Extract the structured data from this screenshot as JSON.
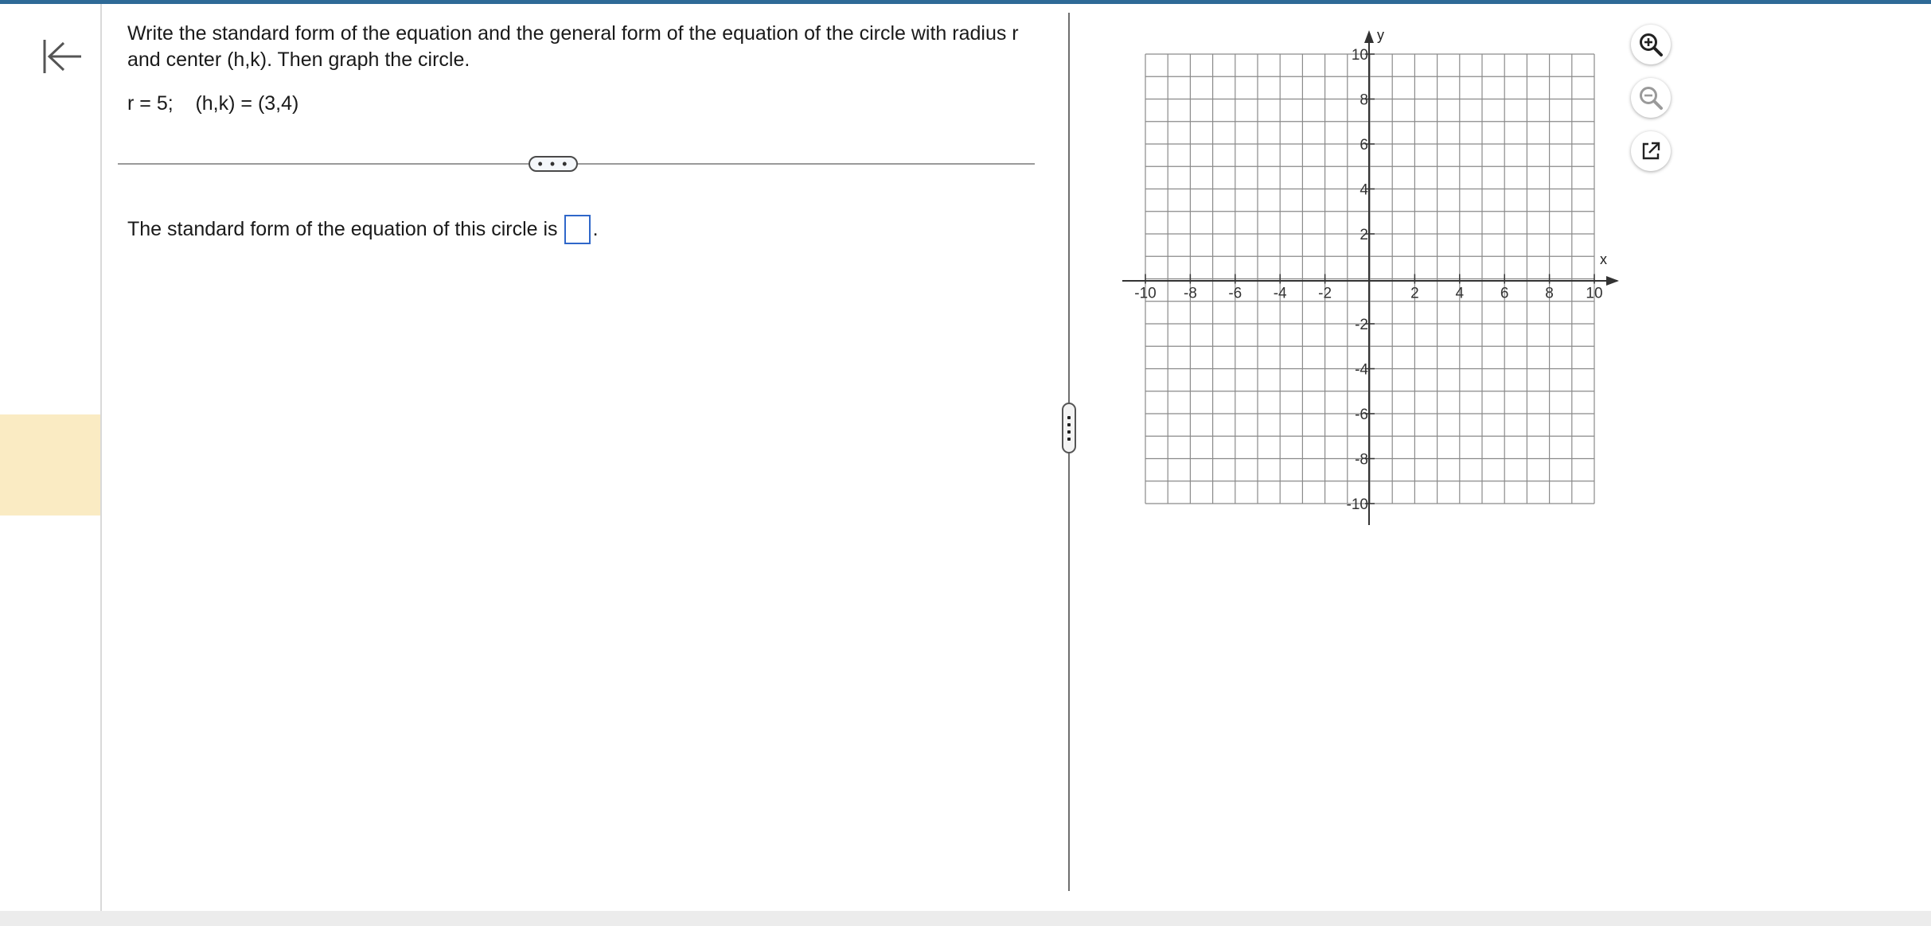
{
  "question": {
    "prompt": "Write the standard form of the equation and the general form of the equation of the circle with radius r and center (h,k). Then graph the circle.",
    "given": "r = 5;    (h,k) = (3,4)"
  },
  "divider": {
    "more_label": "• • •"
  },
  "answer": {
    "label": "The standard form of the equation of this circle is",
    "box_value": "",
    "suffix": "."
  },
  "graph": {
    "x_axis_label": "x",
    "y_axis_label": "y",
    "range": [
      -10,
      10
    ],
    "x_tick_labels": [
      "-10",
      "-8",
      "-6",
      "-4",
      "-2",
      "2",
      "4",
      "6",
      "8",
      "10"
    ],
    "y_tick_labels": [
      "10",
      "8",
      "6",
      "4",
      "2",
      "-2",
      "-4",
      "-6",
      "-8",
      "-10"
    ],
    "grid": true
  },
  "tools": [
    "zoom-in-icon",
    "zoom-out-icon",
    "external-link-icon"
  ],
  "colors": {
    "top_bar": "#2e6a97",
    "rail_highlight": "#faebc3",
    "answer_box_border": "#2f67c9"
  }
}
